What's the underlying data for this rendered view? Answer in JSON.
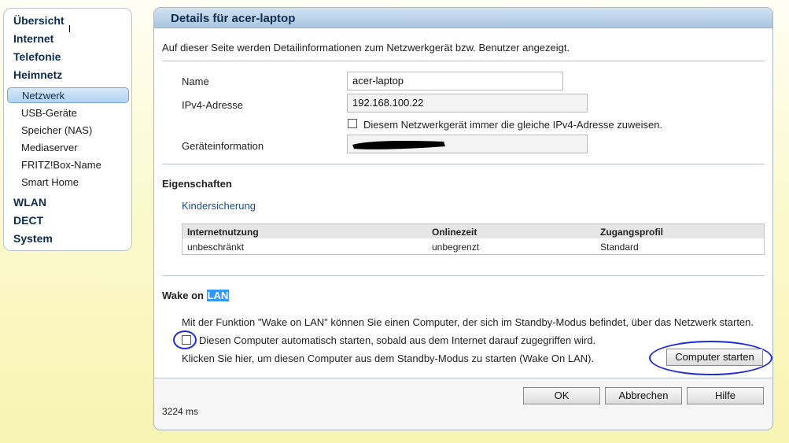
{
  "sidebar": {
    "main_items": [
      "Übersicht",
      "Internet",
      "Telefonie",
      "Heimnetz",
      "WLAN",
      "DECT",
      "System"
    ],
    "sub_items": [
      "Netzwerk",
      "USB-Geräte",
      "Speicher (NAS)",
      "Mediaserver",
      "FRITZ!Box-Name",
      "Smart Home"
    ],
    "active_sub": "Netzwerk"
  },
  "panel": {
    "title": "Details für acer-laptop",
    "description": "Auf dieser Seite werden Detailinformationen zum Netzwerkgerät bzw. Benutzer angezeigt."
  },
  "device": {
    "name_label": "Name",
    "name_value": "acer-laptop",
    "ipv4_label": "IPv4-Adresse",
    "ipv4_value": "192.168.100.22",
    "same_ip_checkbox_label": "Diesem Netzwerkgerät immer die gleiche IPv4-Adresse zuweisen.",
    "same_ip_checked": false,
    "info_label": "Geräteinformation",
    "info_value": ""
  },
  "properties": {
    "title": "Eigenschaften",
    "kinder_link": "Kindersicherung",
    "table": {
      "headers": [
        "Internetnutzung",
        "Onlinezeit",
        "Zugangsprofil"
      ],
      "rows": [
        [
          "unbeschränkt",
          "unbegrenzt",
          "Standard"
        ]
      ]
    }
  },
  "wol": {
    "title_prefix": "Wake on",
    "title_highlight": "LAN",
    "description": "Mit der Funktion \"Wake on LAN\" können Sie einen Computer, der sich im Standby-Modus befindet, über das Netzwerk starten.",
    "auto_start_label": "Diesen Computer automatisch starten, sobald aus dem Internet darauf zugegriffen wird.",
    "auto_start_checked": false,
    "manual_text": "Klicken Sie hier, um diesen Computer aus dem Standby-Modus zu starten (Wake On LAN).",
    "start_button": "Computer starten"
  },
  "footer": {
    "ok": "OK",
    "cancel": "Abbrechen",
    "help": "Hilfe",
    "timing": "3224 ms"
  },
  "colors": {
    "annotation_circle": "#1d2bd8",
    "selection_highlight": "#3399ff",
    "nav_text": "#0e2d4e"
  }
}
